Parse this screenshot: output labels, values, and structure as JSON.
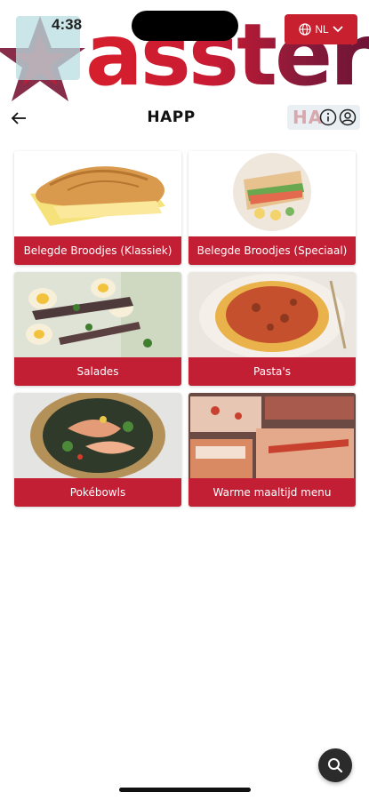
{
  "status_bar": {
    "time": "4:38"
  },
  "banner": {
    "brand_text": "asster",
    "language_code": "NL"
  },
  "header": {
    "title": "HAPP",
    "right_text": "HA"
  },
  "categories": [
    {
      "label": "Belegde Broodjes (Klassiek)",
      "image": "baguette-sandwich"
    },
    {
      "label": "Belegde Broodjes (Speciaal)",
      "image": "club-sandwich-plate"
    },
    {
      "label": "Salades",
      "image": "egg-salad"
    },
    {
      "label": "Pasta's",
      "image": "spaghetti-bolognese"
    },
    {
      "label": "Pokébowls",
      "image": "poke-bowl"
    },
    {
      "label": "Warme maaltijd menu",
      "image": "hot-meal-trays"
    }
  ],
  "colors": {
    "brand_red": "#c21e34",
    "accent_dark_red": "#6e1436",
    "fab": "#2b2b2b"
  },
  "icons": [
    "back-arrow-icon",
    "globe-icon",
    "chevron-down-icon",
    "info-icon",
    "account-icon",
    "search-icon"
  ]
}
